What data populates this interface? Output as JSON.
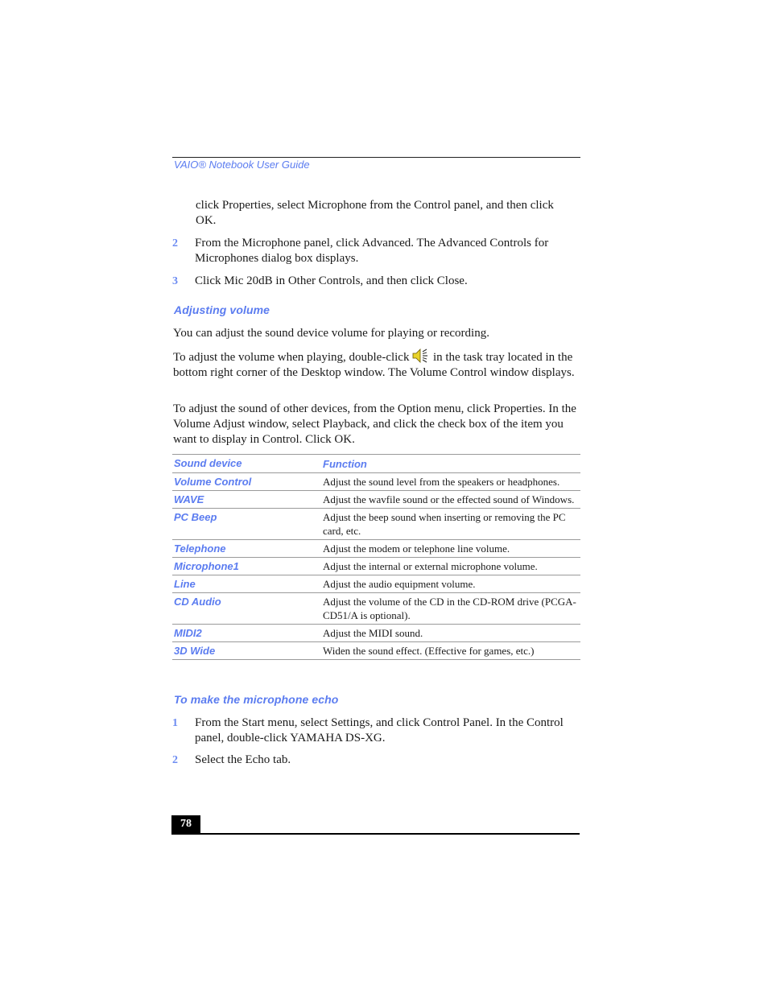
{
  "header": {
    "running_head": "VAIO® Notebook User Guide"
  },
  "intro_continuation": {
    "text": "click Properties, select Microphone from the Control panel, and then click OK."
  },
  "steps_top": [
    {
      "num": "2",
      "text": "From the Microphone panel, click Advanced. The Advanced Controls for Microphones dialog box displays."
    },
    {
      "num": "3",
      "text": "Click Mic 20dB in Other Controls, and then click Close."
    }
  ],
  "adjusting_volume": {
    "heading": "Adjusting volume",
    "para1": "You can adjust the sound device volume for playing or recording.",
    "para2_before_icon": "To adjust the volume when playing, double-click ",
    "para2_icon": "speaker-volume-icon",
    "para2_after_icon": " in the task tray located in the bottom right corner of the Desktop window. The Volume Control window displays.",
    "para3": "To adjust the sound of other devices, from the Option menu, click Properties. In the Volume Adjust window, select Playback, and click the check box of the item you want to display in Control. Click OK."
  },
  "table": {
    "headers": [
      "Sound device",
      "Function"
    ],
    "rows": [
      {
        "device": "Volume Control",
        "function": "Adjust the sound level from the speakers or headphones."
      },
      {
        "device": "WAVE",
        "function": "Adjust the wavfile sound or the effected sound of Windows."
      },
      {
        "device": "PC Beep",
        "function": "Adjust the beep sound when inserting or removing the PC card, etc."
      },
      {
        "device": "Telephone",
        "function": "Adjust the modem or telephone line volume."
      },
      {
        "device": "Microphone1",
        "function": "Adjust the internal or external microphone volume."
      },
      {
        "device": "Line",
        "function": "Adjust the audio equipment volume."
      },
      {
        "device": "CD Audio",
        "function": "Adjust the volume of the CD in the CD-ROM drive (PCGA-CD51/A is optional)."
      },
      {
        "device": "MIDI2",
        "function": "Adjust the MIDI sound."
      },
      {
        "device": "3D Wide",
        "function": "Widen the sound effect. (Effective for games, etc.)"
      }
    ]
  },
  "microphone_echo": {
    "heading": "To make the microphone echo",
    "steps": [
      {
        "num": "1",
        "text": "From the Start menu, select Settings, and click Control Panel. In the Control panel, double-click YAMAHA DS-XG."
      },
      {
        "num": "2",
        "text": "Select the Echo tab."
      }
    ]
  },
  "footer": {
    "page_number": "78"
  },
  "colors": {
    "accent": "#5b7cf0",
    "text": "#1a1a1a",
    "rule": "#9a9a9a"
  }
}
